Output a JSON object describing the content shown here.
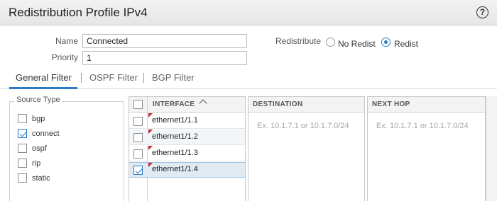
{
  "window": {
    "title": "Redistribution Profile IPv4",
    "help_icon": "?"
  },
  "form": {
    "name_label": "Name",
    "name_value": "Connected",
    "priority_label": "Priority",
    "priority_value": "1",
    "redistribute_label": "Redistribute",
    "redistribute_options": [
      {
        "label": "No Redist",
        "selected": false
      },
      {
        "label": "Redist",
        "selected": true
      }
    ]
  },
  "tabs": [
    {
      "label": "General Filter",
      "active": true
    },
    {
      "label": "OSPF Filter",
      "active": false
    },
    {
      "label": "BGP Filter",
      "active": false
    }
  ],
  "source_type": {
    "legend": "Source Type",
    "items": [
      {
        "label": "bgp",
        "checked": false
      },
      {
        "label": "connect",
        "checked": true
      },
      {
        "label": "ospf",
        "checked": false
      },
      {
        "label": "rip",
        "checked": false
      },
      {
        "label": "static",
        "checked": false
      }
    ]
  },
  "interface_grid": {
    "header": "INTERFACE",
    "rows": [
      {
        "label": "ethernet1/1.1",
        "checked": false
      },
      {
        "label": "ethernet1/1.2",
        "checked": false
      },
      {
        "label": "ethernet1/1.3",
        "checked": false
      },
      {
        "label": "ethernet1/1.4",
        "checked": true
      }
    ]
  },
  "destination_grid": {
    "header": "DESTINATION",
    "placeholder": "Ex. 10.1.7.1 or 10.1.7.0/24"
  },
  "nexthop_grid": {
    "header": "NEXT HOP",
    "placeholder": "Ex. 10.1.7.1 or 10.1.7.0/24"
  },
  "colors": {
    "accent": "#2a7bc6",
    "flag": "#c0242d"
  }
}
